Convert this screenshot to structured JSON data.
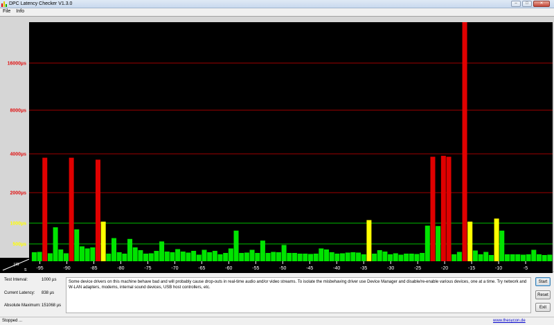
{
  "window": {
    "title": "DPC Latency Checker V1.3.0",
    "buttons": [
      "–",
      "□",
      "✕"
    ]
  },
  "menu": [
    "File",
    "Info"
  ],
  "chart_data": {
    "type": "bar",
    "y_unit": "µs",
    "x_unit": "s",
    "y_scale": "piecewise",
    "y_ticks": [
      {
        "value": 500,
        "label": "500µs",
        "color": "#ffff00",
        "line": "#00c000"
      },
      {
        "value": 1000,
        "label": "1000µs",
        "color": "#ffff00",
        "line": "#00c000"
      },
      {
        "value": 2000,
        "label": "2000µs",
        "color": "#e01010",
        "line": "#a00000"
      },
      {
        "value": 4000,
        "label": "4000µs",
        "color": "#e01010",
        "line": "#a00000"
      },
      {
        "value": 8000,
        "label": "8000µs",
        "color": "#e01010",
        "line": "#a00000"
      },
      {
        "value": 16000,
        "label": "16000µs",
        "color": "#e01010",
        "line": "#a00000"
      }
    ],
    "x_ticks": [
      -95,
      -90,
      -85,
      -80,
      -75,
      -70,
      -65,
      -60,
      -55,
      -50,
      -45,
      -40,
      -35,
      -30,
      -25,
      -20,
      -15,
      -10,
      -5
    ],
    "x_range": [
      -97,
      0
    ],
    "bar_width_s": 0.9,
    "colors": {
      "ok": "#00e400",
      "warn": "#ffff00",
      "bad": "#e00000",
      "background": "#000000"
    },
    "values": [
      260,
      270,
      3800,
      230,
      900,
      340,
      230,
      3800,
      850,
      430,
      370,
      400,
      3700,
      1050,
      220,
      640,
      260,
      220,
      620,
      400,
      320,
      220,
      230,
      300,
      560,
      280,
      260,
      350,
      280,
      250,
      300,
      190,
      330,
      260,
      300,
      200,
      240,
      370,
      820,
      240,
      250,
      330,
      240,
      580,
      240,
      270,
      260,
      470,
      240,
      240,
      220,
      220,
      210,
      220,
      370,
      340,
      260,
      220,
      230,
      250,
      260,
      250,
      200,
      1100,
      220,
      320,
      280,
      200,
      230,
      190,
      220,
      220,
      210,
      240,
      940,
      3850,
      930,
      3900,
      3850,
      200,
      270,
      38000,
      1050,
      310,
      200,
      270,
      180,
      1150,
      820,
      200,
      200,
      200,
      190,
      200,
      330,
      200,
      180,
      190
    ]
  },
  "info": {
    "test_interval_label": "Test Interval:",
    "test_interval_value": "1000 µs",
    "current_latency_label": "Current Latency:",
    "current_latency_value": "838 µs",
    "absolute_maximum_label": "Absolute Maximum:",
    "absolute_maximum_value": "151068 µs",
    "message": "Some device drivers on this machine behave bad and will probably cause drop-outs in real-time audio and/or video streams. To isolate the misbehaving driver use Device Manager and disable/re-enable various devices, one at a time. Try network and W-LAN adapters, modems, internal sound devices, USB host controllers, etc."
  },
  "buttons": {
    "start": "Start",
    "reset": "Reset",
    "exit": "Exit"
  },
  "status": {
    "text": "Stopped ...",
    "link": "www.thesycon.de"
  }
}
